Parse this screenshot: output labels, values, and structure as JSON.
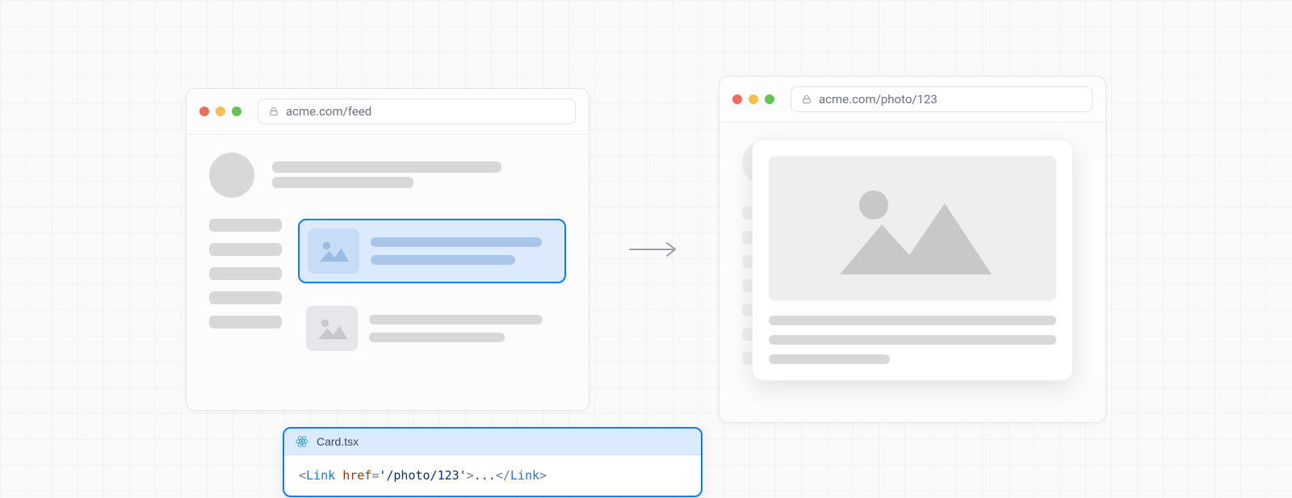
{
  "browser_left": {
    "url": "acme.com/feed"
  },
  "browser_right": {
    "url": "acme.com/photo/123"
  },
  "code_chip": {
    "filename": "Card.tsx",
    "tag": "Link",
    "attr": "href",
    "attr_value": "'/photo/123'",
    "inner": "..."
  },
  "icons": {
    "lock": "lock-icon",
    "react": "react-icon",
    "arrow": "arrow-right-icon",
    "image_placeholder": "image-placeholder-icon"
  }
}
